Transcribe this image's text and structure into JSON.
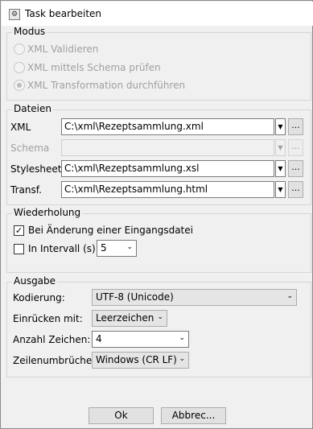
{
  "window": {
    "title": "Task bearbeiten",
    "icon": "gear-icon"
  },
  "modus": {
    "legend": "Modus",
    "options": [
      {
        "label": "XML Validieren",
        "selected": false
      },
      {
        "label": "XML mittels Schema prüfen",
        "selected": false
      },
      {
        "label": "XML Transformation durchführen",
        "selected": true
      }
    ]
  },
  "dateien": {
    "legend": "Dateien",
    "rows": [
      {
        "label": "XML",
        "value": "C:\\xml\\Rezeptsammlung.xml",
        "enabled": true
      },
      {
        "label": "Schema",
        "value": "",
        "enabled": false
      },
      {
        "label": "Stylesheet",
        "value": "C:\\xml\\Rezeptsammlung.xsl",
        "enabled": true
      },
      {
        "label": "Transf.",
        "value": "C:\\xml\\Rezeptsammlung.html",
        "enabled": true
      }
    ],
    "browse_label": "..."
  },
  "wiederholung": {
    "legend": "Wiederholung",
    "on_change_label": "Bei Änderung einer Eingangsdatei",
    "on_change_checked": true,
    "interval_label": "In Intervall (s):",
    "interval_checked": false,
    "interval_value": "5"
  },
  "ausgabe": {
    "legend": "Ausgabe",
    "encoding_label": "Kodierung:",
    "encoding_value": "UTF-8 (Unicode)",
    "indent_label": "Einrücken mit:",
    "indent_value": "Leerzeichen",
    "count_label": "Anzahl Zeichen:",
    "count_value": "4",
    "linebreak_label": "Zeilenumbrüche:",
    "linebreak_value": "Windows (CR LF)"
  },
  "buttons": {
    "ok": "Ok",
    "cancel": "Abbrec..."
  }
}
